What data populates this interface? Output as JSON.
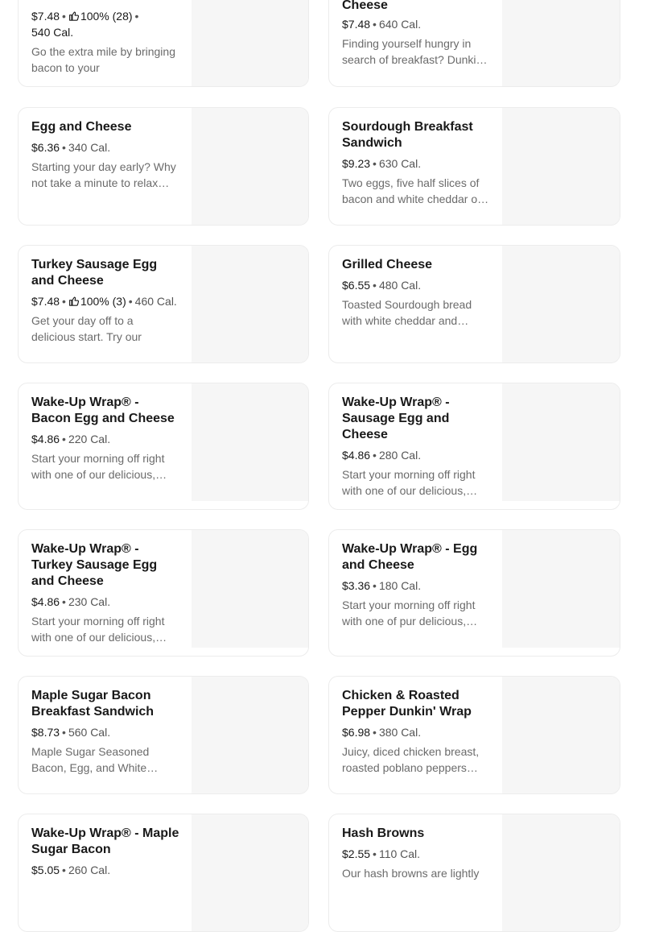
{
  "items": [
    {
      "title": "",
      "price": "$7.48",
      "rating": "100% (28)",
      "calories": "540 Cal.",
      "desc": "Go the extra mile by bringing bacon to your"
    },
    {
      "title": "Cheese",
      "price": "$7.48",
      "rating": "",
      "calories": "640 Cal.",
      "desc": "Finding yourself hungry in search of breakfast? Dunki…"
    },
    {
      "title": "Egg and Cheese",
      "price": "$6.36",
      "rating": "",
      "calories": "340 Cal.",
      "desc": "Starting your day early? Why not take a minute to relax…"
    },
    {
      "title": "Sourdough Breakfast Sandwich",
      "price": "$9.23",
      "rating": "",
      "calories": "630 Cal.",
      "desc": "Two eggs, five half slices of bacon and white cheddar o…"
    },
    {
      "title": "Turkey Sausage Egg and Cheese",
      "price": "$7.48",
      "rating": "100% (3)",
      "calories": "460 Cal.",
      "desc": "Get your day off to a delicious start. Try our"
    },
    {
      "title": "Grilled Cheese",
      "price": "$6.55",
      "rating": "",
      "calories": "480 Cal.",
      "desc": "Toasted Sourdough bread with white cheddar and…"
    },
    {
      "title": "Wake-Up Wrap® - Bacon Egg and Cheese",
      "price": "$4.86",
      "rating": "",
      "calories": "220 Cal.",
      "desc": "Start your morning off right with one of our delicious,…"
    },
    {
      "title": "Wake-Up Wrap® - Sausage Egg and Cheese",
      "price": "$4.86",
      "rating": "",
      "calories": "280 Cal.",
      "desc": "Start your morning off right with one of our delicious,…"
    },
    {
      "title": "Wake-Up Wrap® - Turkey Sausage Egg and Cheese",
      "price": "$4.86",
      "rating": "",
      "calories": "230 Cal.",
      "desc": "Start your morning off right with one of our delicious,…"
    },
    {
      "title": "Wake-Up Wrap® - Egg and Cheese",
      "price": "$3.36",
      "rating": "",
      "calories": "180 Cal.",
      "desc": "Start your morning off right with one of pur delicious,…"
    },
    {
      "title": "Maple Sugar Bacon Breakfast Sandwich",
      "price": "$8.73",
      "rating": "",
      "calories": "560 Cal.",
      "desc": "Maple Sugar Seasoned Bacon, Egg, and White…"
    },
    {
      "title": "Chicken & Roasted Pepper Dunkin' Wrap",
      "price": "$6.98",
      "rating": "",
      "calories": "380 Cal.",
      "desc": "Juicy, diced chicken breast, roasted poblano peppers…"
    },
    {
      "title": "Wake-Up Wrap® - Maple Sugar Bacon",
      "price": "$5.05",
      "rating": "",
      "calories": "260 Cal.",
      "desc": ""
    },
    {
      "title": "Hash Browns",
      "price": "$2.55",
      "rating": "",
      "calories": "110 Cal.",
      "desc": "Our hash browns are lightly"
    }
  ]
}
